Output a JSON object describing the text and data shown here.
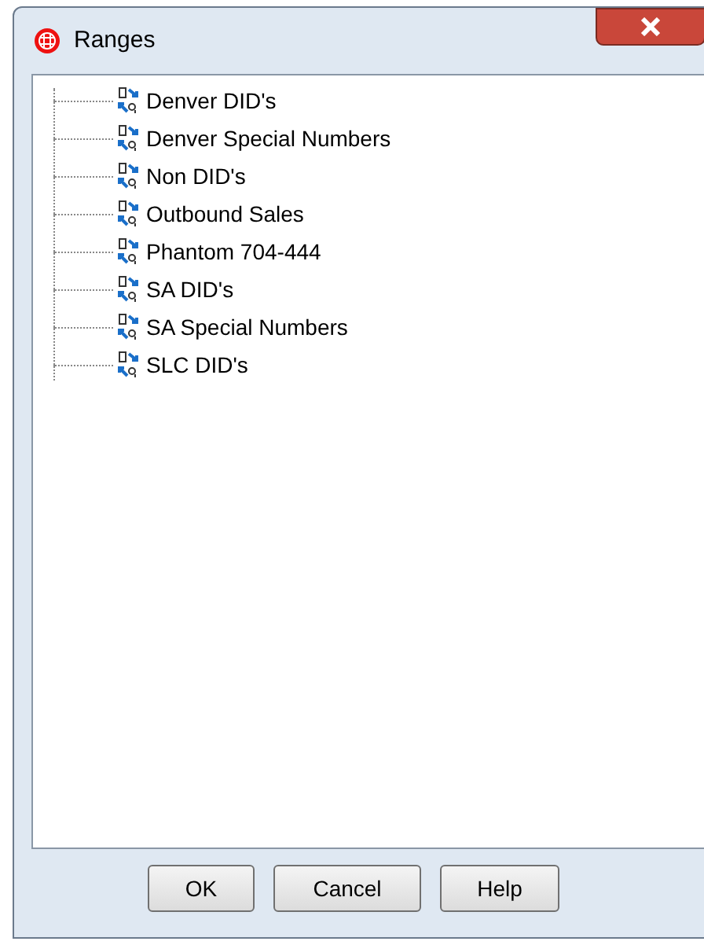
{
  "window": {
    "title": "Ranges"
  },
  "tree": {
    "items": [
      {
        "label": "Denver DID's"
      },
      {
        "label": "Denver Special Numbers"
      },
      {
        "label": "Non DID's"
      },
      {
        "label": "Outbound Sales"
      },
      {
        "label": "Phantom 704-444"
      },
      {
        "label": "SA DID's"
      },
      {
        "label": "SA Special Numbers"
      },
      {
        "label": "SLC DID's"
      }
    ]
  },
  "buttons": [
    {
      "label": "OK"
    },
    {
      "label": "Cancel"
    },
    {
      "label": "Help"
    }
  ]
}
